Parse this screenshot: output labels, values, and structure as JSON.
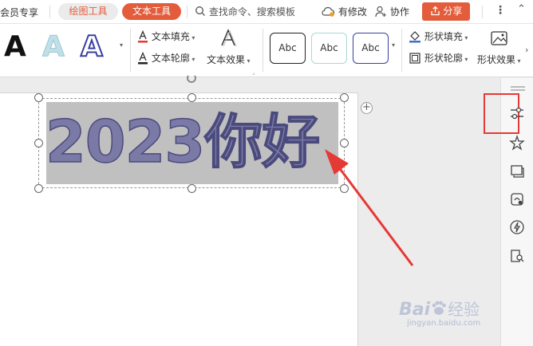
{
  "topbar": {
    "vip_label": "会员专享",
    "tab_draw": "绘图工具",
    "tab_text": "文本工具",
    "search_placeholder": "查找命令、搜索模板",
    "modified_label": "有修改",
    "collab_label": "协作",
    "share_label": "分享"
  },
  "ribbon": {
    "text_fill": "文本填充",
    "text_outline": "文本轮廓",
    "text_effect": "文本效果",
    "preset_1": "Abc",
    "preset_2": "Abc",
    "preset_3": "Abc",
    "shape_fill": "形状填充",
    "shape_outline": "形状轮廓",
    "shape_effect": "形状效果",
    "art_letter": "A"
  },
  "document": {
    "art_text": "2023你好"
  },
  "watermark": {
    "brand": "Bai",
    "brand_suffix": "经验",
    "url": "jingyan.baidu.com"
  },
  "colors": {
    "accent": "#e35d3c",
    "art_fill": "#7b7aa6",
    "art_outline": "#4b4a7d",
    "selection_bg": "#c0c0c0",
    "highlight_box": "#e53935"
  }
}
